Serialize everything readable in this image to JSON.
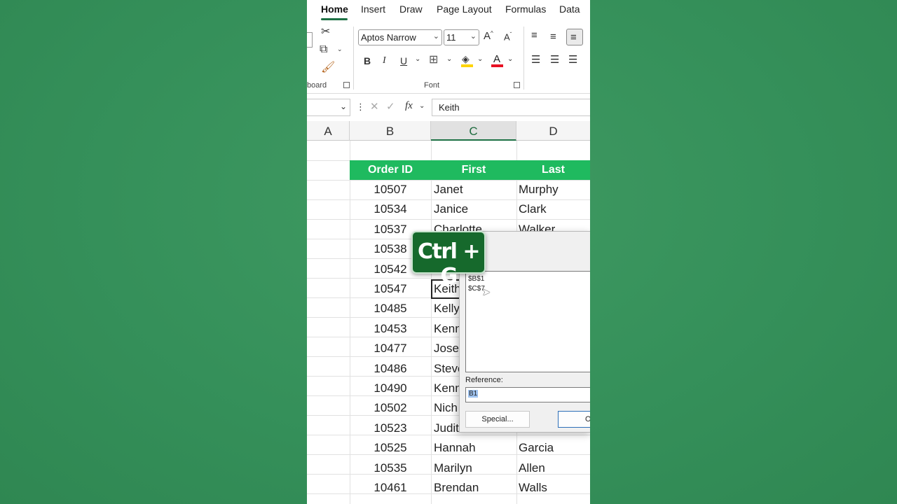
{
  "ribbon": {
    "tabs": [
      "Home",
      "Insert",
      "Draw",
      "Page Layout",
      "Formulas",
      "Data"
    ],
    "active_tab": "Home",
    "font_name": "Aptos Narrow",
    "font_size": "11",
    "bold_label": "B",
    "italic_label": "I",
    "underline_label": "U",
    "clipboard_group": "board",
    "font_group": "Font",
    "highlight_color": "#ffd400",
    "font_color": "#e81123"
  },
  "formula_bar": {
    "fx_label": "fx",
    "value": "Keith"
  },
  "columns": [
    "A",
    "B",
    "C",
    "D"
  ],
  "selected_column": "C",
  "table": {
    "headers": [
      "Order ID",
      "First",
      "Last"
    ],
    "header_color": "#1fba5f",
    "rows": [
      {
        "id": "10507",
        "first": "Janet",
        "last": "Murphy"
      },
      {
        "id": "10534",
        "first": "Janice",
        "last": "Clark"
      },
      {
        "id": "10537",
        "first": "Charlotte",
        "last": "Walker"
      },
      {
        "id": "10538",
        "first": "",
        "last": ""
      },
      {
        "id": "10542",
        "first": "",
        "last": ""
      },
      {
        "id": "10547",
        "first": "Keith",
        "last": ""
      },
      {
        "id": "10485",
        "first": "Kelly",
        "last": ""
      },
      {
        "id": "10453",
        "first": "Kenn",
        "last": ""
      },
      {
        "id": "10477",
        "first": "Josep",
        "last": ""
      },
      {
        "id": "10486",
        "first": "Steve",
        "last": ""
      },
      {
        "id": "10490",
        "first": "Kenn",
        "last": ""
      },
      {
        "id": "10502",
        "first": "Nich",
        "last": ""
      },
      {
        "id": "10523",
        "first": "Judith",
        "last": ""
      },
      {
        "id": "10525",
        "first": "Hannah",
        "last": "Garcia"
      },
      {
        "id": "10535",
        "first": "Marilyn",
        "last": "Allen"
      },
      {
        "id": "10461",
        "first": "Brendan",
        "last": "Walls"
      }
    ]
  },
  "goto_dialog": {
    "list_items": [
      "$B$1",
      "$C$7"
    ],
    "reference_label": "Reference:",
    "reference_value": "B1",
    "special_button": "Special...",
    "ok_button": "O"
  },
  "shortcut_badge": "Ctrl + G"
}
